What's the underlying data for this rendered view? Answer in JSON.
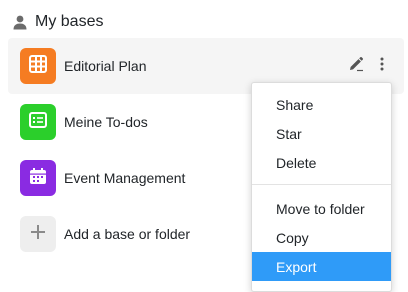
{
  "section": {
    "title": "My bases",
    "icon": "user-icon"
  },
  "bases": [
    {
      "label": "Editorial Plan",
      "color": "#f57c22",
      "icon": "grid-table-icon",
      "hovered": true
    },
    {
      "label": "Meine To-dos",
      "color": "#2bcf2b",
      "icon": "checklist-icon",
      "hovered": false
    },
    {
      "label": "Event Management",
      "color": "#8a2be2",
      "icon": "calendar-icon",
      "hovered": false
    }
  ],
  "add": {
    "label": "Add a base or folder",
    "icon": "plus-icon"
  },
  "row_actions": {
    "edit_icon": "pencil-icon",
    "more_icon": "more-vertical-icon"
  },
  "menu": {
    "items": [
      {
        "label": "Share",
        "active": false
      },
      {
        "label": "Star",
        "active": false
      },
      {
        "label": "Delete",
        "active": false
      },
      {
        "label": "Move to folder",
        "active": false
      },
      {
        "label": "Copy",
        "active": false
      },
      {
        "label": "Export",
        "active": true
      }
    ],
    "active_color": "#2f9bf8"
  }
}
